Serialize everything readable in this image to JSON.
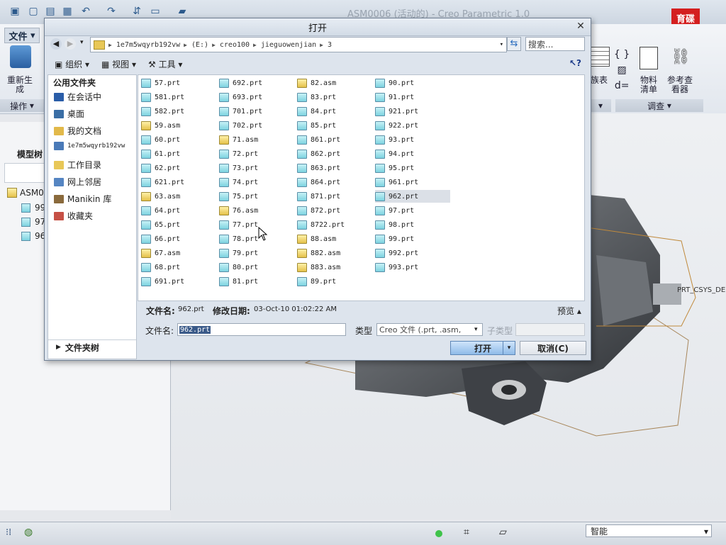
{
  "app": {
    "title": "ASM0006 (活动的) - Creo Parametric 1.0",
    "file_tab": "文件",
    "ribbon_regen": "重新生\n成",
    "group_operations": "操作",
    "family_table": "族表",
    "bom": "物料\n清单",
    "ref_viewer": "参考查\n看器",
    "group_investigate": "调查",
    "model_tree_label": "模型树",
    "tree_root": "ASM0",
    "tree_items": [
      "99",
      "97",
      "96"
    ],
    "csys_label": "PRT_CSYS_DE",
    "smart_filter": "智能",
    "logo_text": "育碟\n软件"
  },
  "dialog": {
    "title": "打开",
    "address": [
      "1e7m5wqyrb192vw",
      "(E:)",
      "creo100",
      "jieguowenjian",
      "3"
    ],
    "search_placeholder": "搜索...",
    "toolbar": {
      "organize": "组织",
      "views": "视图",
      "tools": "工具"
    },
    "nav_header": "公用文件夹",
    "nav_items": [
      {
        "label": "在会话中",
        "color": "#2a5da8"
      },
      {
        "label": "桌面",
        "color": "#3a6ea5"
      },
      {
        "label": "我的文档",
        "color": "#e2b94a"
      },
      {
        "label": "1e7m5wqyrb192vw",
        "color": "#4a7ab8"
      },
      {
        "label": "工作目录",
        "color": "#e8c757"
      },
      {
        "label": "网上邻居",
        "color": "#5585c2"
      },
      {
        "label": "Manikin 库",
        "color": "#8a6a3c"
      },
      {
        "label": "收藏夹",
        "color": "#c65045"
      }
    ],
    "folder_tree": "文件夹树",
    "files": [
      [
        "57.prt",
        "581.prt",
        "582.prt",
        "59.asm",
        "60.prt",
        "61.prt",
        "62.prt",
        "621.prt",
        "63.asm",
        "64.prt",
        "65.prt",
        "66.prt",
        "67.asm",
        "68.prt",
        "691.prt"
      ],
      [
        "692.prt",
        "693.prt",
        "701.prt",
        "702.prt",
        "71.asm",
        "72.prt",
        "73.prt",
        "74.prt",
        "75.prt",
        "76.asm",
        "77.prt",
        "78.prt",
        "79.prt",
        "80.prt",
        "81.prt"
      ],
      [
        "82.asm",
        "83.prt",
        "84.prt",
        "85.prt",
        "861.prt",
        "862.prt",
        "863.prt",
        "864.prt",
        "871.prt",
        "872.prt",
        "8722.prt",
        "88.asm",
        "882.asm",
        "883.asm",
        "89.prt"
      ],
      [
        "90.prt",
        "91.prt",
        "921.prt",
        "922.prt",
        "93.prt",
        "94.prt",
        "95.prt",
        "961.prt",
        "962.prt",
        "97.prt",
        "98.prt",
        "99.prt",
        "992.prt",
        "993.prt"
      ]
    ],
    "selected_file": "962.prt",
    "info": {
      "name_label": "文件名:",
      "name_value": "962.prt",
      "date_label": "修改日期:",
      "date_value": "03-Oct-10 01:02:22 AM",
      "preview": "预览"
    },
    "filename_label": "文件名:",
    "filename_value": "962.prt",
    "type_label": "类型",
    "type_value": "Creo 文件 (.prt, .asm,",
    "subtype_label": "子类型",
    "open_button": "打开",
    "cancel_button": "取消(C)"
  }
}
